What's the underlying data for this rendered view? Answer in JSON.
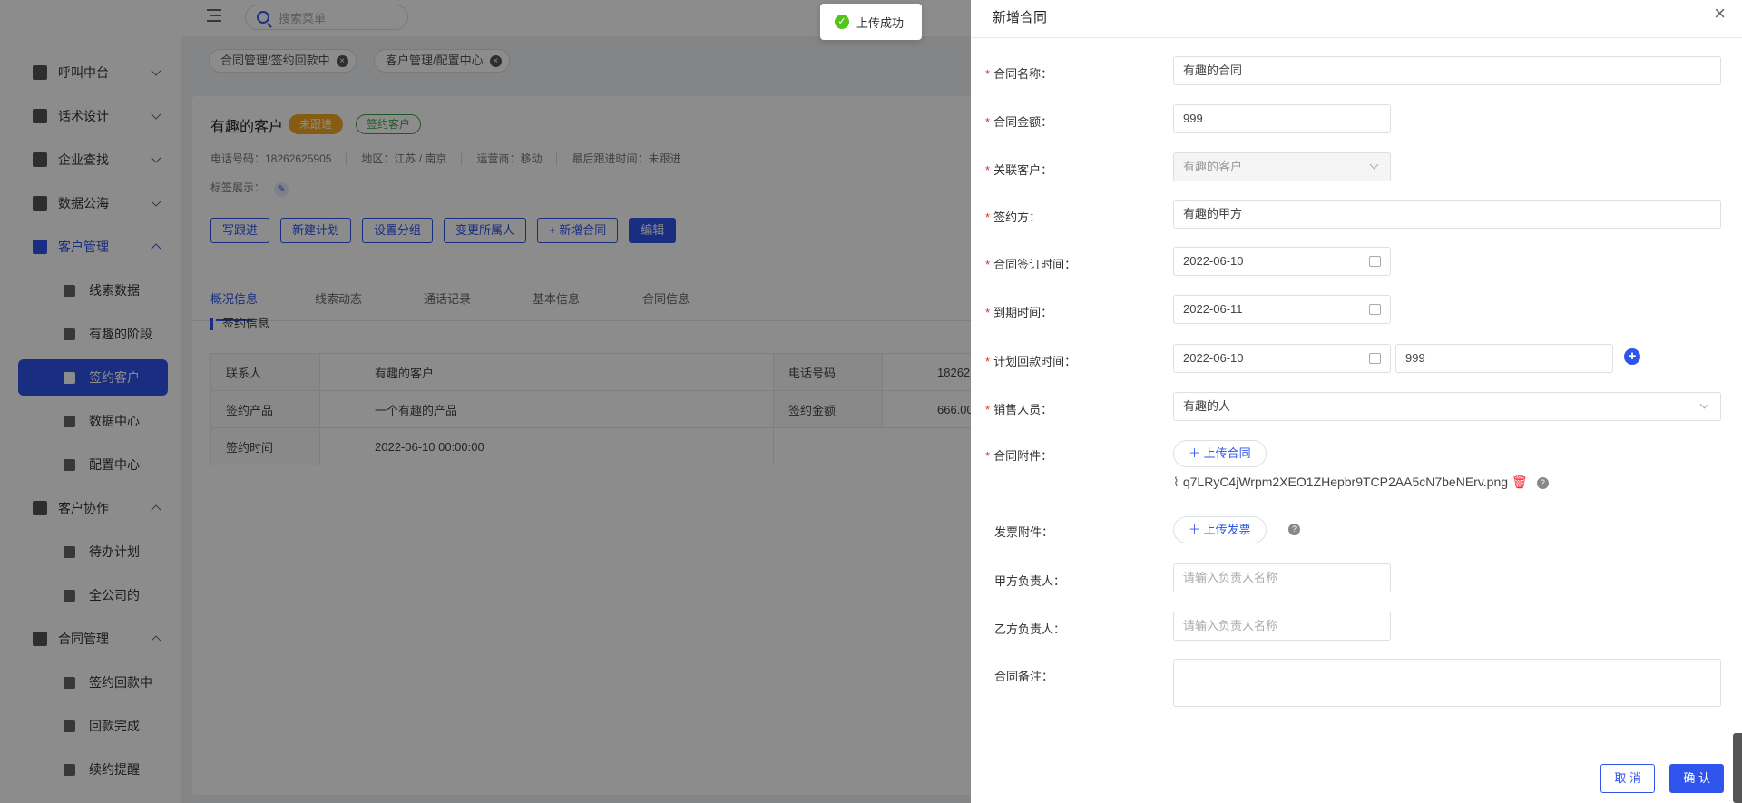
{
  "sidebar": {
    "items": [
      {
        "label": "呼叫中台",
        "icon": "monitor-icon"
      },
      {
        "label": "话术设计",
        "icon": "script-icon"
      },
      {
        "label": "企业查找",
        "icon": "bulb-icon"
      },
      {
        "label": "数据公海",
        "icon": "chart-icon"
      },
      {
        "label": "客户管理",
        "icon": "customer-icon"
      },
      {
        "label": "线索数据",
        "icon": "user-icon"
      },
      {
        "label": "有趣的阶段",
        "icon": "user-icon"
      },
      {
        "label": "签约客户",
        "icon": "contract-icon"
      },
      {
        "label": "数据中心",
        "icon": "bar-icon"
      },
      {
        "label": "配置中心",
        "icon": "user-icon"
      },
      {
        "label": "客户协作",
        "icon": "team-icon"
      },
      {
        "label": "待办计划",
        "icon": "alarm-icon"
      },
      {
        "label": "全公司的",
        "icon": "bar-icon"
      },
      {
        "label": "合同管理",
        "icon": "clipboard-icon"
      },
      {
        "label": "签约回款中",
        "icon": "doc-icon"
      },
      {
        "label": "回款完成",
        "icon": "doc-icon"
      },
      {
        "label": "续约提醒",
        "icon": "doc-icon"
      }
    ]
  },
  "topbar": {
    "search_placeholder": "搜索菜单"
  },
  "page_tags": [
    "合同管理/签约回款中",
    "客户管理/配置中心"
  ],
  "customer": {
    "name": "有趣的客户",
    "badge1": "未跟进",
    "badge2": "签约客户",
    "phone": "电话号码：18262625905",
    "region": "地区：江苏 / 南京",
    "carrier": "运营商：移动",
    "last_follow": "最后跟进时间：未跟进",
    "tag_label": "标签展示："
  },
  "actions": [
    "写跟进",
    "新建计划",
    "设置分组",
    "变更所属人",
    "+ 新增合同",
    "编辑"
  ],
  "tabs": [
    "概况信息",
    "线索动态",
    "通话记录",
    "基本信息",
    "合同信息"
  ],
  "section_title": "签约信息",
  "info_table": [
    [
      "联系人",
      "有趣的客户",
      "电话号码",
      "18262"
    ],
    [
      "签约产品",
      "一个有趣的产品",
      "签约金额",
      "666.00"
    ],
    [
      "签约时间",
      "2022-06-10 00:00:00",
      "",
      ""
    ]
  ],
  "toast": {
    "text": "上传成功"
  },
  "drawer": {
    "title": "新增合同",
    "fields": {
      "name_label": "合同名称：",
      "name_value": "有趣的合同",
      "amount_label": "合同金额：",
      "amount_value": "999",
      "customer_label": "关联客户：",
      "customer_value": "有趣的客户",
      "party_label": "签约方：",
      "party_value": "有趣的甲方",
      "sign_date_label": "合同签订时间：",
      "sign_date_value": "2022-06-10",
      "expire_label": "到期时间：",
      "expire_value": "2022-06-11",
      "plan_label": "计划回款时间：",
      "plan_date_value": "2022-06-10",
      "plan_amount_value": "999",
      "sales_label": "销售人员：",
      "sales_value": "有趣的人",
      "attach_label": "合同附件：",
      "attach_button": "上传合同",
      "attach_file": "q7LRyC4jWrpm2XEO1ZHepbr9TCP2AA5cN7beNErv.png",
      "invoice_label": "发票附件：",
      "invoice_button": "上传发票",
      "partyA_label": "甲方负责人：",
      "partyA_placeholder": "请输入负责人名称",
      "partyB_label": "乙方负责人：",
      "partyB_placeholder": "请输入负责人名称",
      "remark_label": "合同备注："
    },
    "cancel": "取 消",
    "confirm": "确 认"
  },
  "colors": {
    "primary": "#2f54eb",
    "required": "#f5222d",
    "success": "#52c41a",
    "warning": "#f5a623"
  }
}
